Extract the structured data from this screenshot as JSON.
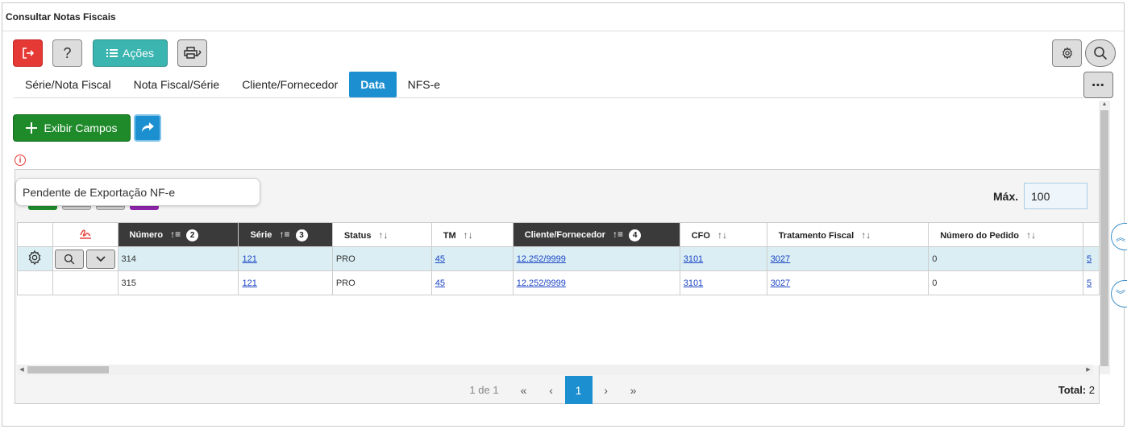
{
  "window": {
    "title": "Consultar Notas Fiscais"
  },
  "toolbar": {
    "exit_icon": "exit-icon",
    "help_label": "?",
    "acoes_label": "Ações",
    "print_icon": "print-icon",
    "settings_icon": "gear-icon",
    "search_icon": "search-icon",
    "more_label": "⋯"
  },
  "tabs": [
    {
      "label": "Série/Nota Fiscal",
      "active": false
    },
    {
      "label": "Nota Fiscal/Série",
      "active": false
    },
    {
      "label": "Cliente/Fornecedor",
      "active": false
    },
    {
      "label": "Data",
      "active": true
    },
    {
      "label": "NFS-e",
      "active": false
    }
  ],
  "actions": {
    "exibir_campos_label": "Exibir Campos"
  },
  "tooltip": {
    "text": "Pendente de Exportação NF-e"
  },
  "max": {
    "label": "Máx.",
    "value": "100"
  },
  "status_colors": [
    "#1e8a2a",
    "#cccccc",
    "#cccccc",
    "#8e24aa"
  ],
  "table": {
    "columns": [
      {
        "label": "Número",
        "sorted": true,
        "order": "2"
      },
      {
        "label": "Série",
        "sorted": true,
        "order": "3"
      },
      {
        "label": "Status",
        "sorted": false,
        "order": ""
      },
      {
        "label": "TM",
        "sorted": false,
        "order": ""
      },
      {
        "label": "Cliente/Fornecedor",
        "sorted": true,
        "order": "4"
      },
      {
        "label": "CFO",
        "sorted": false,
        "order": ""
      },
      {
        "label": "Tratamento Fiscal",
        "sorted": false,
        "order": ""
      },
      {
        "label": "Número do Pedido",
        "sorted": false,
        "order": ""
      }
    ],
    "rows": [
      {
        "numero": "314",
        "serie": "121",
        "status": "PRO",
        "tm": "45",
        "cliente": "12.252/9999",
        "cfo": "3101",
        "tratamento": "3027",
        "pedido": "0",
        "extra": "5",
        "selected": true
      },
      {
        "numero": "315",
        "serie": "121",
        "status": "PRO",
        "tm": "45",
        "cliente": "12.252/9999",
        "cfo": "3101",
        "tratamento": "3027",
        "pedido": "0",
        "extra": "5",
        "selected": false
      }
    ]
  },
  "pager": {
    "info": "1 de 1",
    "current": "1",
    "total_label": "Total:",
    "total_value": "2"
  }
}
